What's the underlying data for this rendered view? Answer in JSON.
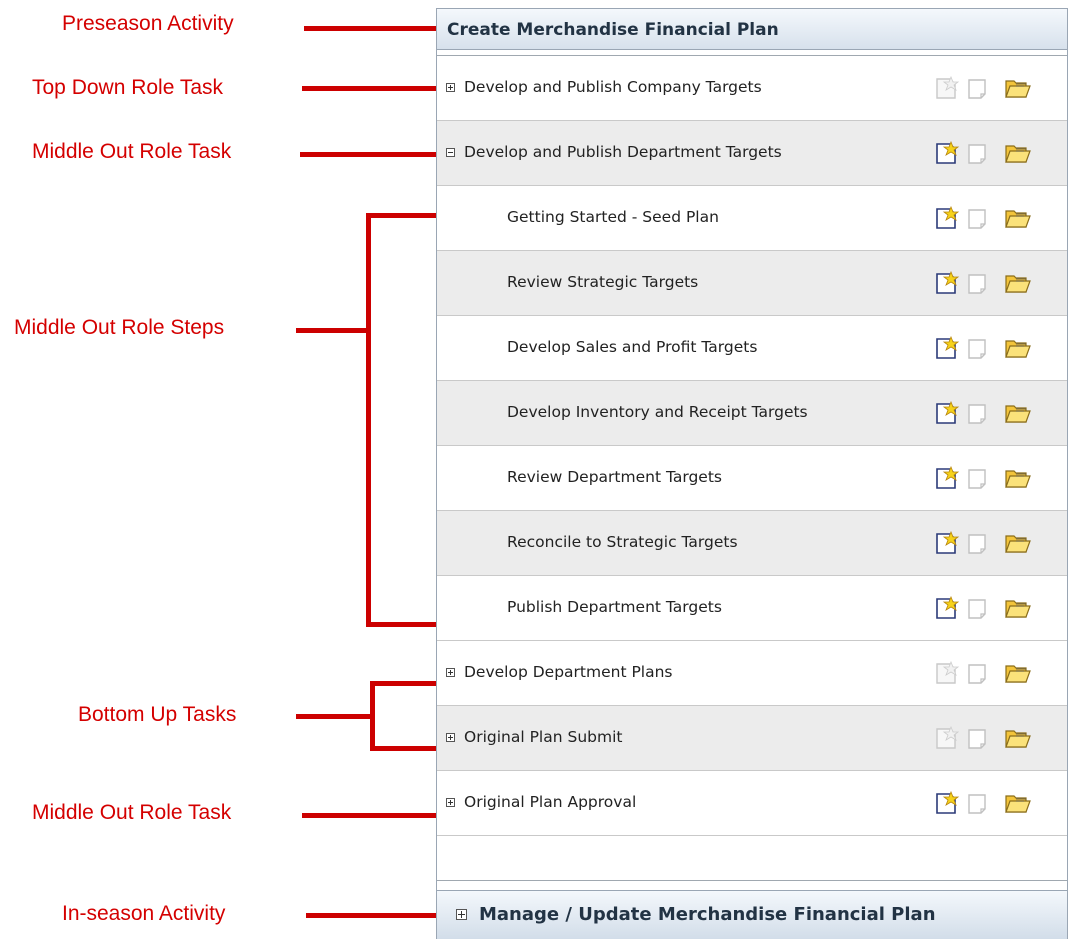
{
  "annotations": {
    "preseason_activity": "Preseason Activity",
    "top_down_role_task": "Top Down Role Task",
    "middle_out_role_task_1": "Middle Out Role Task",
    "middle_out_role_steps": "Middle Out Role Steps",
    "bottom_up_tasks": "Bottom Up Tasks",
    "middle_out_role_task_2": "Middle Out Role Task",
    "inseason_activity": "In-season Activity"
  },
  "panel": {
    "header_title": "Create Merchandise Financial Plan",
    "rows": [
      {
        "label": "Develop and Publish Company Targets",
        "kind": "task",
        "expander": "plus",
        "new_icon": "disabled"
      },
      {
        "label": "Develop and Publish Department Targets",
        "kind": "task",
        "expander": "minus",
        "new_icon": "enabled"
      },
      {
        "label": "Getting Started - Seed Plan",
        "kind": "step",
        "new_icon": "enabled"
      },
      {
        "label": "Review Strategic Targets",
        "kind": "step",
        "new_icon": "enabled"
      },
      {
        "label": "Develop Sales and Profit Targets",
        "kind": "step",
        "new_icon": "enabled"
      },
      {
        "label": "Develop Inventory and Receipt Targets",
        "kind": "step",
        "new_icon": "enabled"
      },
      {
        "label": "Review Department Targets",
        "kind": "step",
        "new_icon": "enabled"
      },
      {
        "label": "Reconcile to Strategic Targets",
        "kind": "step",
        "new_icon": "enabled"
      },
      {
        "label": "Publish Department Targets",
        "kind": "step",
        "new_icon": "enabled"
      },
      {
        "label": "Develop Department Plans",
        "kind": "task",
        "expander": "plus",
        "new_icon": "disabled"
      },
      {
        "label": "Original Plan Submit",
        "kind": "task",
        "expander": "plus",
        "new_icon": "disabled"
      },
      {
        "label": "Original Plan Approval",
        "kind": "task",
        "expander": "plus",
        "new_icon": "enabled"
      }
    ],
    "footer_title": "Manage / Update Merchandise Financial Plan"
  },
  "colors": {
    "annotation_red": "#cc0000",
    "header_gradient": [
      "#f4f8fc",
      "#d7e1ec"
    ],
    "row_shade": "#ececec",
    "folder_yellow": "#f3c43a"
  },
  "icons": [
    "new-workbook-icon",
    "document-icon",
    "open-folder-icon",
    "expand-icon",
    "collapse-icon"
  ]
}
